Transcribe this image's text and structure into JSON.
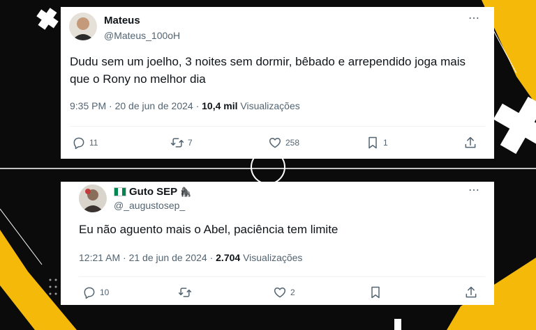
{
  "tweets": [
    {
      "name": "Mateus",
      "handle": "@Mateus_100oH",
      "text": "Dudu sem um joelho, 3 noites sem dormir, bêbado e arrependido joga mais que o Rony no melhor dia",
      "time": "9:35 PM · 20 de jun de 2024 · ",
      "views_count": "10,4 mil",
      "views_label": " Visualizações",
      "replies": "11",
      "retweets": "7",
      "likes": "258",
      "bookmarks": "1"
    },
    {
      "name": "Guto SEP",
      "handle": "@_augustosep_",
      "text": "Eu não aguento mais o Abel, paciência tem limite",
      "time": "12:21 AM · 21 de jun de 2024 · ",
      "views_count": "2.704",
      "views_label": " Visualizações",
      "replies": "10",
      "retweets": "",
      "likes": "2",
      "bookmarks": ""
    }
  ],
  "more_icon": "⋯",
  "name_emoji": "🦍",
  "icons": [
    "reply-icon",
    "retweet-icon",
    "like-icon",
    "bookmark-icon",
    "share-icon",
    "more-icon",
    "nigeria-flag-icon",
    "gorilla-icon"
  ],
  "colors": {
    "accent": "#f5b90a",
    "background": "#0b0b0b",
    "text_secondary": "#536471"
  }
}
